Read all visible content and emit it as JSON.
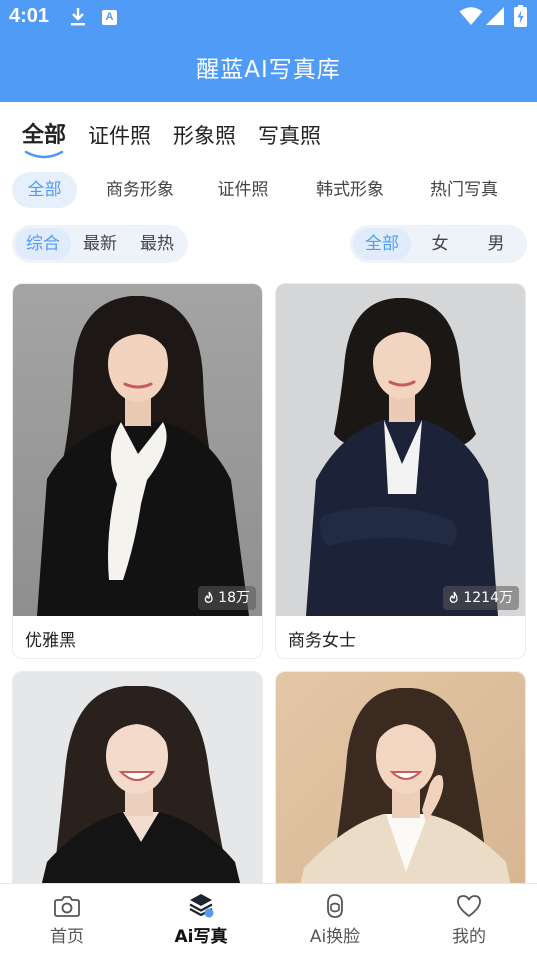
{
  "status_bar": {
    "time": "4:01"
  },
  "header": {
    "title": "醒蓝AI写真库"
  },
  "primary_tabs": [
    {
      "label": "全部"
    },
    {
      "label": "证件照"
    },
    {
      "label": "形象照"
    },
    {
      "label": "写真照"
    }
  ],
  "categories": [
    {
      "label": "全部"
    },
    {
      "label": "商务形象"
    },
    {
      "label": "证件照"
    },
    {
      "label": "韩式形象"
    },
    {
      "label": "热门写真"
    }
  ],
  "sort_options": [
    {
      "label": "综合"
    },
    {
      "label": "最新"
    },
    {
      "label": "最热"
    }
  ],
  "gender_options": [
    {
      "label": "全部"
    },
    {
      "label": "女"
    },
    {
      "label": "男"
    }
  ],
  "cards": [
    {
      "title": "优雅黑",
      "count": "18万"
    },
    {
      "title": "商务女士",
      "count": "1214万"
    },
    {
      "title": "",
      "count": ""
    },
    {
      "title": "",
      "count": ""
    }
  ],
  "bottom_nav": [
    {
      "label": "首页",
      "icon": "camera-icon"
    },
    {
      "label": "Ai写真",
      "icon": "layers-icon"
    },
    {
      "label": "Ai换脸",
      "icon": "face-icon"
    },
    {
      "label": "我的",
      "icon": "heart-icon"
    }
  ],
  "colors": {
    "accent": "#4f9bf5",
    "chip_bg": "#e6f0fc",
    "pill_group_bg": "#eef3fa"
  }
}
